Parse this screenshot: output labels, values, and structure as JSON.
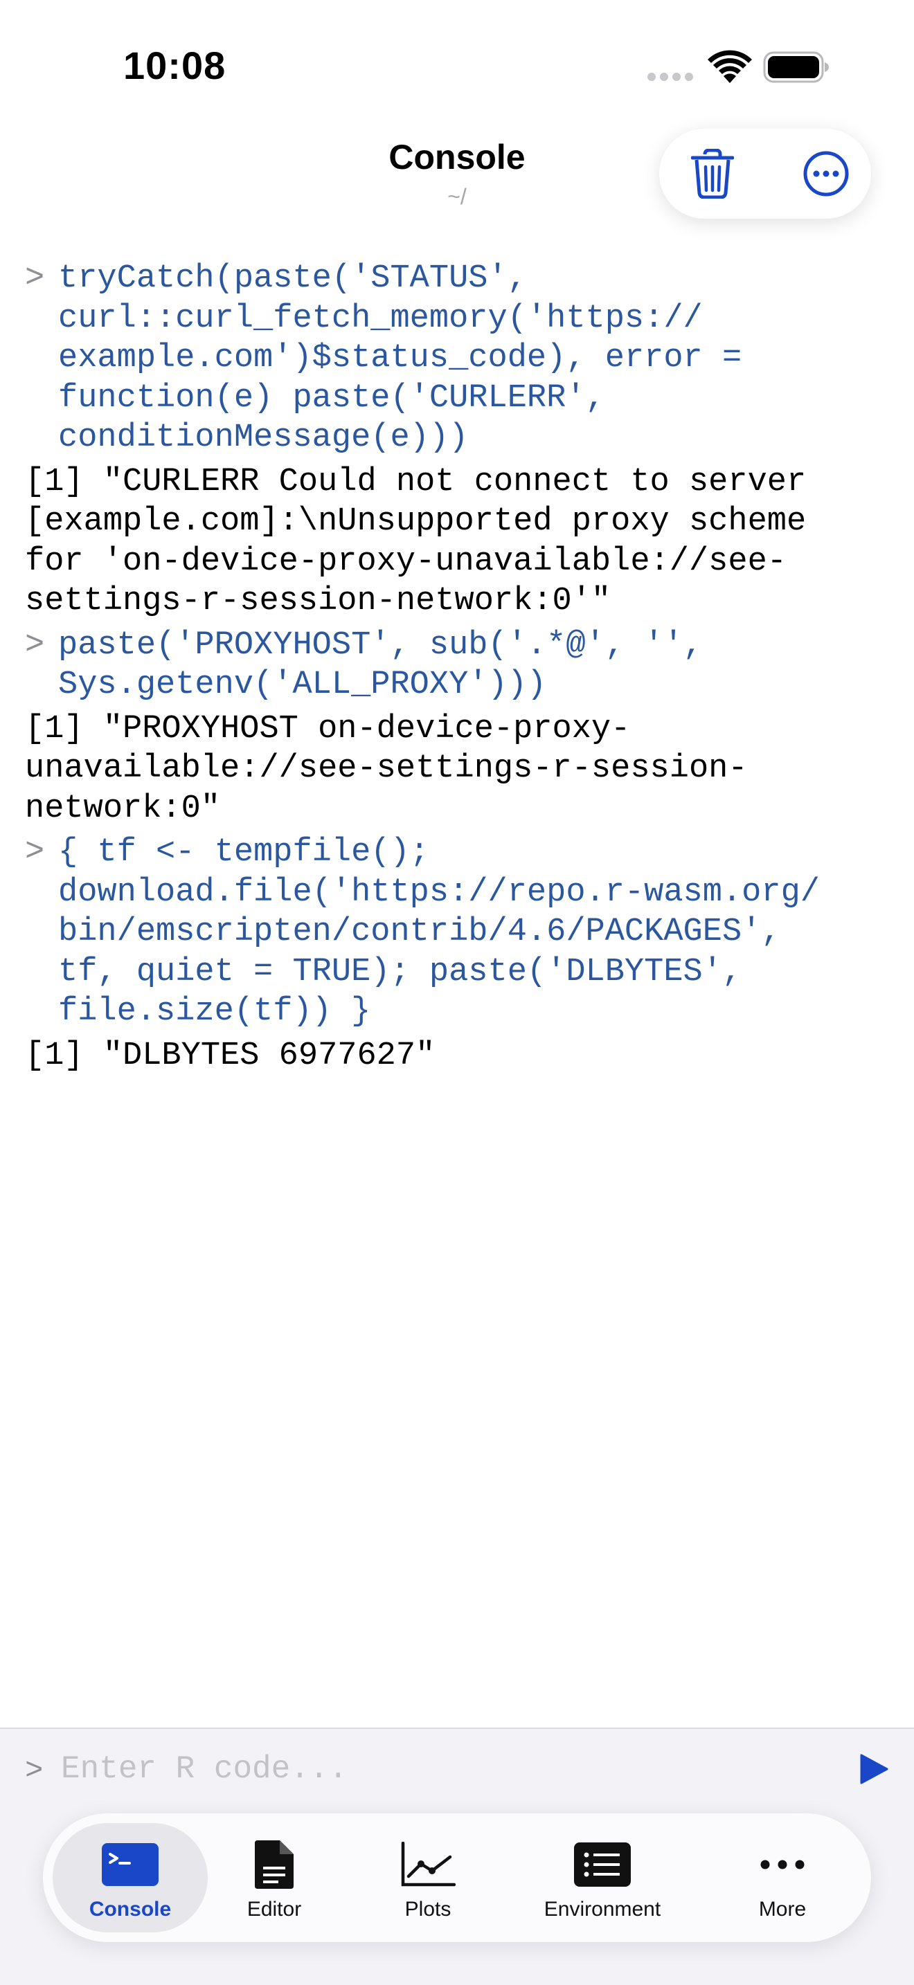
{
  "status_bar": {
    "time": "10:08",
    "icons": [
      "signal-dots-icon",
      "wifi-icon",
      "battery-icon"
    ]
  },
  "header": {
    "title": "Console",
    "subtitle": "~/",
    "actions": [
      "trash-icon",
      "ellipsis-circle-icon"
    ]
  },
  "console": {
    "prompt": ">",
    "entries": [
      {
        "command": "tryCatch(paste('STATUS',\ncurl::curl_fetch_memory('https://\nexample.com')$status_code), error =\nfunction(e) paste('CURLERR',\nconditionMessage(e)))",
        "output": "[1] \"CURLERR Could not connect to server\n[example.com]:\\nUnsupported proxy scheme\nfor 'on-device-proxy-unavailable://see-\nsettings-r-session-network:0'\""
      },
      {
        "command": "paste('PROXYHOST', sub('.*@', '',\nSys.getenv('ALL_PROXY')))",
        "output": "[1] \"PROXYHOST on-device-proxy-\nunavailable://see-settings-r-session-\nnetwork:0\""
      },
      {
        "command": "{ tf <- tempfile();\ndownload.file('https://repo.r-wasm.org/\nbin/emscripten/contrib/4.6/PACKAGES',\ntf, quiet = TRUE); paste('DLBYTES',\nfile.size(tf)) }",
        "output": "[1] \"DLBYTES 6977627\""
      }
    ]
  },
  "input": {
    "prompt": ">",
    "placeholder": "Enter R code...",
    "value": ""
  },
  "tabs": [
    {
      "label": "Console",
      "icon": "terminal-icon",
      "active": true
    },
    {
      "label": "Editor",
      "icon": "document-icon",
      "active": false
    },
    {
      "label": "Plots",
      "icon": "line-chart-icon",
      "active": false
    },
    {
      "label": "Environment",
      "icon": "list-icon",
      "active": false
    },
    {
      "label": "More",
      "icon": "ellipsis-icon",
      "active": false
    }
  ],
  "colors": {
    "accent": "#1947c8",
    "command_text": "#2a579e",
    "output_text": "#000000",
    "muted": "#8e8e93"
  }
}
